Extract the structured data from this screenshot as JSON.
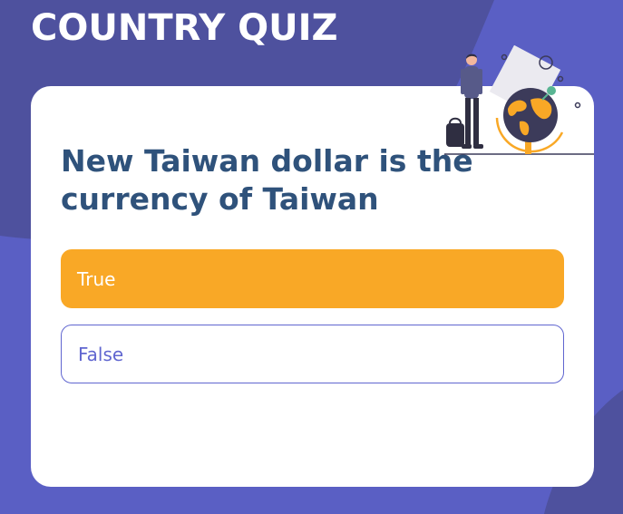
{
  "app": {
    "title": "COUNTRY QUIZ"
  },
  "quiz": {
    "question": "New Taiwan dollar is the currency of Taiwan",
    "options": [
      {
        "label": "True",
        "state": "selected"
      },
      {
        "label": "False",
        "state": "unselected"
      }
    ]
  },
  "illustration": {
    "icon": "traveler-globe-icon"
  },
  "colors": {
    "background": "#5a5fc4",
    "background_shape": "#4e519e",
    "card": "#ffffff",
    "question_text": "#2f527b",
    "accent_selected": "#f9a826",
    "option_outline": "#6066d0",
    "globe": "#3c3b5a"
  }
}
